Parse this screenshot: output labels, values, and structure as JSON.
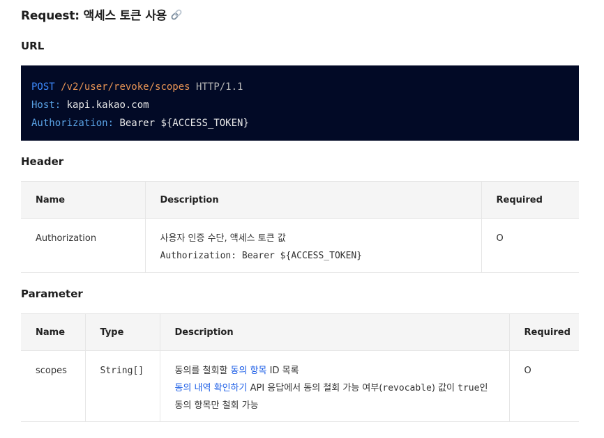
{
  "page": {
    "title": "Request: 액세스 토큰 사용",
    "title_icon": "link-icon"
  },
  "sections": {
    "url": "URL",
    "header": "Header",
    "parameter": "Parameter"
  },
  "code": {
    "method": "POST",
    "path": "/v2/user/revoke/scopes",
    "protocol": "HTTP/1.1",
    "host_key": "Host:",
    "host_value": "kapi.kakao.com",
    "auth_key": "Authorization:",
    "auth_value": "Bearer ${ACCESS_TOKEN}"
  },
  "header_table": {
    "columns": [
      "Name",
      "Description",
      "Required"
    ],
    "rows": [
      {
        "name": "Authorization",
        "desc_line1": "사용자 인증 수단, 액세스 토큰 값",
        "desc_line2": "Authorization: Bearer ${ACCESS_TOKEN}",
        "required": "O"
      }
    ]
  },
  "parameter_table": {
    "columns": [
      "Name",
      "Type",
      "Description",
      "Required"
    ],
    "rows": [
      {
        "name": "scopes",
        "type": "String[]",
        "desc_a": "동의를 철회할 ",
        "desc_link1": "동의 항목",
        "desc_b": " ID 목록",
        "desc_link2": "동의 내역 확인하기",
        "desc_c": " API 응답에서 동의 철회 가능 여부(",
        "desc_code1": "revocable",
        "desc_d": ") 값이 ",
        "desc_code2": "true",
        "desc_e": "인",
        "desc_f": "동의 항목만 철회 가능",
        "required": "O"
      }
    ]
  },
  "colors": {
    "code_bg": "#020a26",
    "link": "#1a5ce6",
    "table_head_bg": "#f5f5f5"
  }
}
